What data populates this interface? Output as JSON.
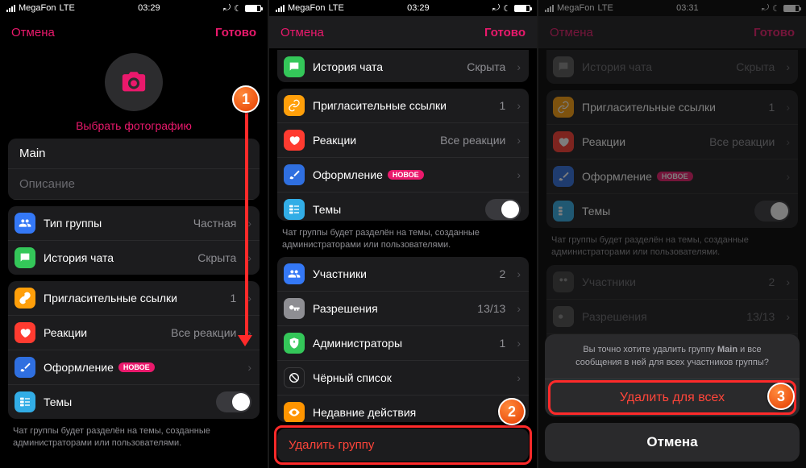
{
  "status": {
    "carrier": "MegaFon",
    "net": "LTE",
    "time1": "03:29",
    "time2": "03:29",
    "time3": "03:31"
  },
  "nav": {
    "cancel": "Отмена",
    "done": "Готово"
  },
  "p1": {
    "choose_photo": "Выбрать фотографию",
    "name_value": "Main",
    "desc_placeholder": "Описание",
    "rows": {
      "type": {
        "label": "Тип группы",
        "value": "Частная"
      },
      "history": {
        "label": "История чата",
        "value": "Скрыта"
      },
      "links": {
        "label": "Пригласительные ссылки",
        "value": "1"
      },
      "reactions": {
        "label": "Реакции",
        "value": "Все реакции"
      },
      "appearance": {
        "label": "Оформление",
        "badge": "НОВОЕ"
      },
      "topics": {
        "label": "Темы"
      }
    },
    "note": "Чат группы будет разделён на темы, созданные администраторами или пользователями."
  },
  "p2": {
    "history": {
      "label": "История чата",
      "value": "Скрыта"
    },
    "links": {
      "label": "Пригласительные ссылки",
      "value": "1"
    },
    "reactions": {
      "label": "Реакции",
      "value": "Все реакции"
    },
    "appearance": {
      "label": "Оформление",
      "badge": "НОВОЕ"
    },
    "topics": {
      "label": "Темы"
    },
    "note": "Чат группы будет разделён на темы, созданные администраторами или пользователями.",
    "members": {
      "label": "Участники",
      "value": "2"
    },
    "perms": {
      "label": "Разрешения",
      "value": "13/13"
    },
    "admins": {
      "label": "Администраторы",
      "value": "1"
    },
    "blacklist": {
      "label": "Чёрный список",
      "value": ""
    },
    "recent": {
      "label": "Недавние действия",
      "value": ""
    },
    "delete": "Удалить группу"
  },
  "p3": {
    "sheet_msg_a": "Вы точно хотите удалить группу ",
    "sheet_msg_name": "Main",
    "sheet_msg_b": " и все сообщения в ней для всех участников группы?",
    "delete_all": "Удалить для всех",
    "cancel": "Отмена"
  },
  "colors": {
    "blue": "#3478f6",
    "green": "#34c759",
    "orange": "#ff9f0a",
    "red": "#ff3b30",
    "darkblue": "#2f6fe0",
    "cyan": "#32ade6",
    "grey": "#8e8e93",
    "shield": "#34c759",
    "eye": "#ff9500"
  }
}
